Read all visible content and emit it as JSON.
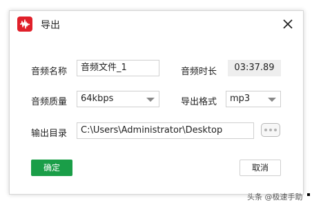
{
  "dialog": {
    "title": "导出",
    "app_icon": "audio-waveform-icon",
    "close_icon": "close-icon"
  },
  "form": {
    "name_label": "音频名称",
    "name_value": "音频文件_1",
    "duration_label": "音频时长",
    "duration_value": "03:37.89",
    "quality_label": "音频质量",
    "quality_value": "64kbps",
    "format_label": "导出格式",
    "format_value": "mp3",
    "dir_label": "输出目录",
    "dir_value": "C:\\Users\\Administrator\\Desktop",
    "browse_icon": "more-dots-icon"
  },
  "buttons": {
    "ok_label": "确定",
    "cancel_label": "取消"
  },
  "watermark": {
    "text": "头条 @极速手助"
  },
  "colors": {
    "accent_red": "#e0202a",
    "ok_green": "#1a9e48"
  }
}
